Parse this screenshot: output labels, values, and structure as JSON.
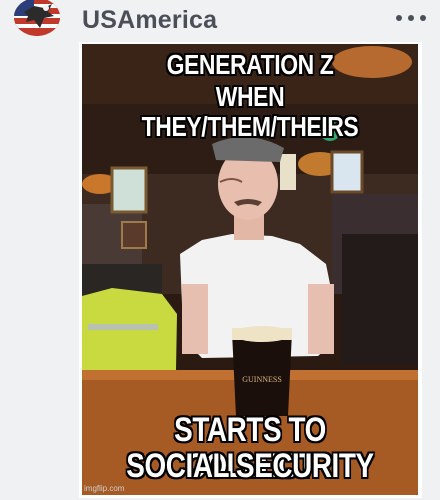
{
  "post": {
    "username": "USAmerica",
    "avatar_icon": "eagle-flag-avatar",
    "more_icon": "more-dots-icon"
  },
  "meme": {
    "top_line1": "GENERATION Z",
    "top_line2": "WHEN THEY/THEM/THEIRS",
    "bottom_line1": "STARTS TO COLLECT",
    "bottom_line2": "SOCIAL SECURITY",
    "glass_text": "GUINNESS",
    "watermark": "imgflip.com"
  },
  "colors": {
    "background": "#f0f1f3",
    "username": "#4b4f58",
    "caption_fill": "#ffffff",
    "caption_stroke": "#000000"
  }
}
